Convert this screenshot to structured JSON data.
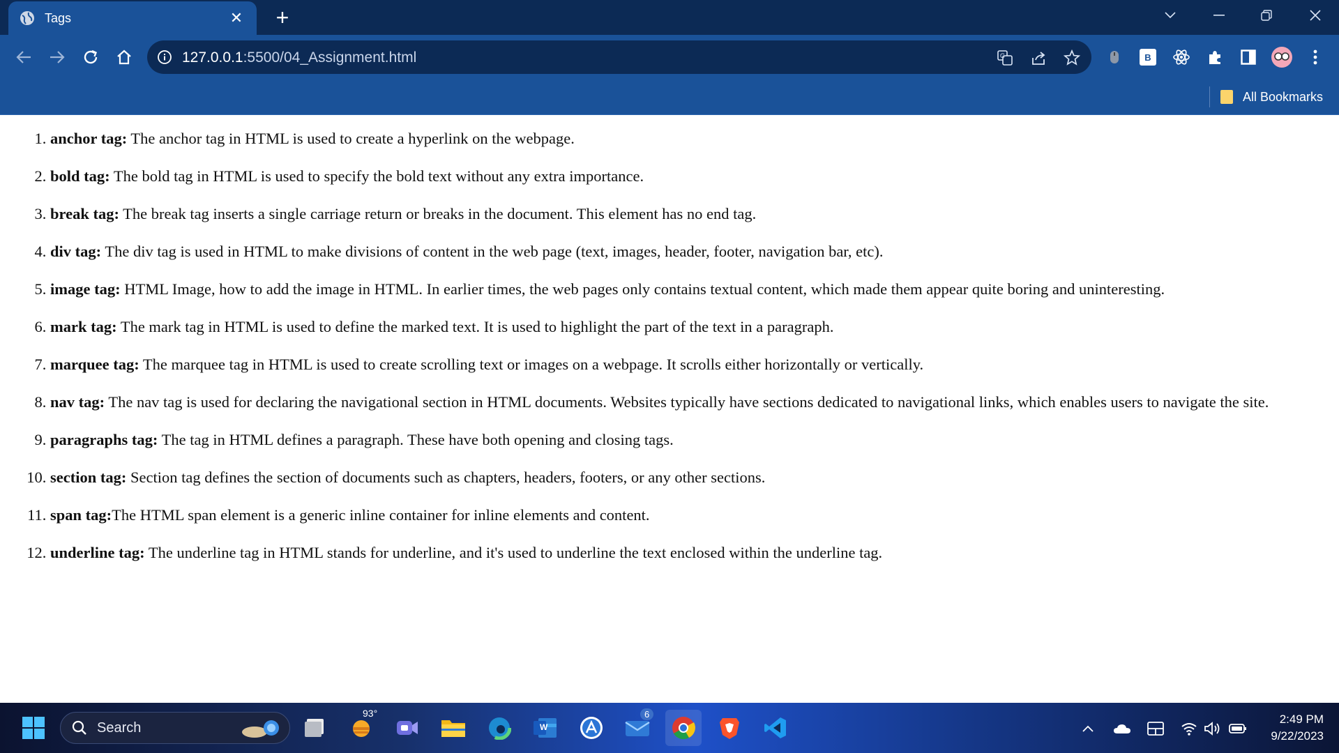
{
  "browser": {
    "tab": {
      "title": "Tags",
      "close_glyph": "✕"
    },
    "new_tab_glyph": "+",
    "url_host": "127.0.0.1",
    "url_path": ":5500/04_Assignment.html",
    "bookmarks": {
      "all_label": "All Bookmarks"
    },
    "extensions": [
      "tab-search-icon",
      "translate-icon",
      "share-icon",
      "bookmark-star-icon",
      "mouse-extension-icon",
      "b-extension-icon",
      "react-devtools-icon",
      "puzzle-extensions-icon",
      "sidepanel-icon",
      "profile-avatar",
      "kebab-menu-icon"
    ],
    "b_extension_letter": "B"
  },
  "page": {
    "items": [
      {
        "term": "anchor tag:",
        "desc": " The anchor tag in HTML is used to create a hyperlink on the webpage."
      },
      {
        "term": "bold tag:",
        "desc": " The bold tag in HTML is used to specify the bold text without any extra importance."
      },
      {
        "term": "break tag:",
        "desc": " The break tag inserts a single carriage return or breaks in the document. This element has no end tag."
      },
      {
        "term": "div tag:",
        "desc": " The div tag is used in HTML to make divisions of content in the web page (text, images, header, footer, navigation bar, etc)."
      },
      {
        "term": "image tag:",
        "desc": " HTML Image, how to add the image in HTML. In earlier times, the web pages only contains textual content, which made them appear quite boring and uninteresting."
      },
      {
        "term": "mark tag:",
        "desc": " The mark tag in HTML is used to define the marked text. It is used to highlight the part of the text in a paragraph."
      },
      {
        "term": "marquee tag:",
        "desc": " The marquee tag in HTML is used to create scrolling text or images on a webpage. It scrolls either horizontally or vertically."
      },
      {
        "term": "nav tag:",
        "desc": " The nav tag is used for declaring the navigational section in HTML documents. Websites typically have sections dedicated to navigational links, which enables users to navigate the site."
      },
      {
        "term": "paragraphs tag:",
        "desc": " The tag in HTML defines a paragraph. These have both opening and closing tags."
      },
      {
        "term": "section tag:",
        "desc": " Section tag defines the section of documents such as chapters, headers, footers, or any other sections."
      },
      {
        "term": "span tag:",
        "desc": "The HTML span element is a generic inline container for inline elements and content."
      },
      {
        "term": "underline tag:",
        "desc": " The underline tag in HTML stands for underline, and it's used to underline the text enclosed within the underline tag."
      }
    ]
  },
  "taskbar": {
    "search_label": "Search",
    "weather_temp": "93°",
    "mail_badge": "6",
    "time": "2:49 PM",
    "date": "9/22/2023",
    "word_letter": "W",
    "apps": [
      "start-icon",
      "search",
      "widgets-icon",
      "file-viewer-icon",
      "weather-icon",
      "teams-meet-icon",
      "file-explorer-icon",
      "edge-icon",
      "word-icon",
      "app-store-icon",
      "mail-icon",
      "chrome-icon",
      "brave-icon",
      "vscode-icon"
    ]
  },
  "colors": {
    "chrome": "#0f3c78",
    "tabstrip": "#0c2a55",
    "toolbar": "#1a5299",
    "omnibox": "#0c2a55"
  }
}
